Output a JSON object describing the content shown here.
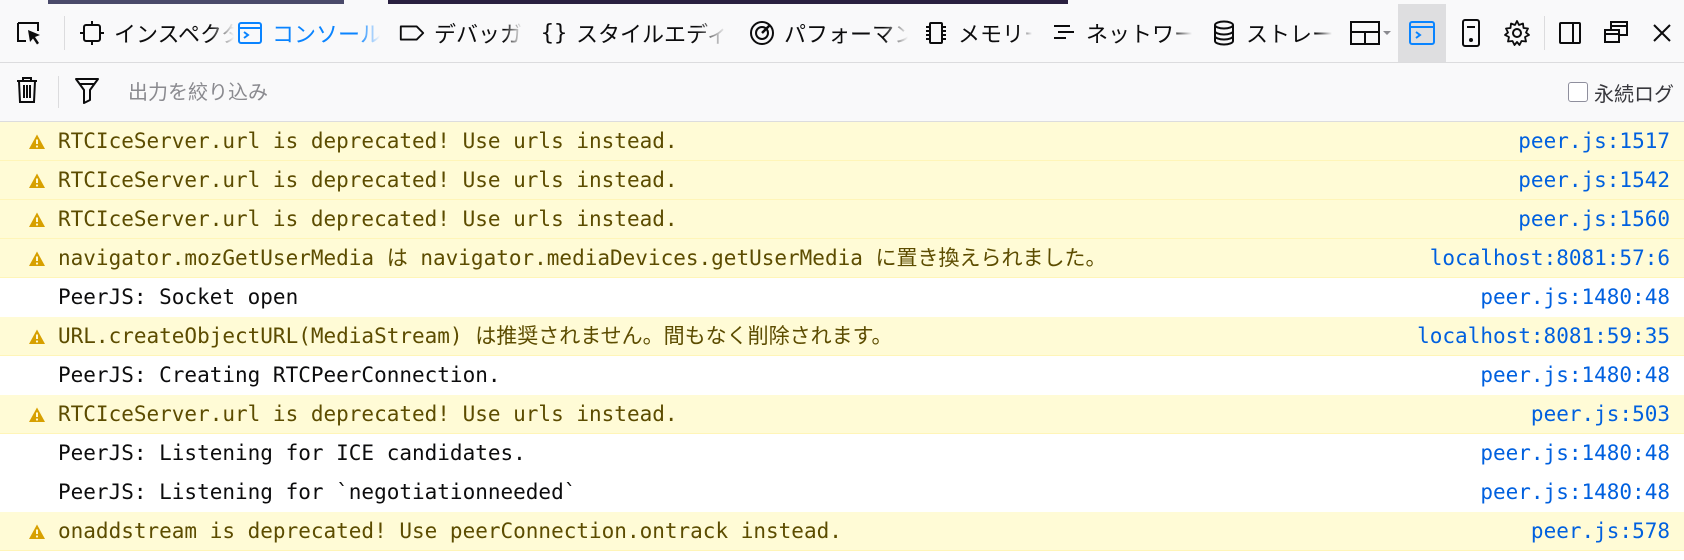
{
  "toolbar": {
    "pick_element_icon": "cursor-pick-icon",
    "tabs": [
      {
        "label": "インスペクター",
        "icon": "inspector-icon"
      },
      {
        "label": "コンソール",
        "icon": "console-icon",
        "selected": true
      },
      {
        "label": "デバッガー",
        "icon": "debugger-icon"
      },
      {
        "label": "スタイルエディター",
        "icon": "style-editor-icon"
      },
      {
        "label": "パフォーマンス",
        "icon": "performance-icon"
      },
      {
        "label": "メモリー",
        "icon": "memory-icon"
      },
      {
        "label": "ネットワーク",
        "icon": "network-icon"
      },
      {
        "label": "ストレージ",
        "icon": "storage-icon"
      }
    ],
    "right_icons": [
      "layout-menu-icon",
      "split-console-icon",
      "responsive-design-icon",
      "settings-gear-icon",
      "dock-side-icon",
      "separate-window-icon",
      "close-icon"
    ]
  },
  "filterbar": {
    "clear_icon": "trash-icon",
    "filter_icon": "filter-icon",
    "placeholder": "出力を絞り込み",
    "persist_label": "永続ログ",
    "persist_checked": false
  },
  "console": {
    "messages": [
      {
        "level": "warn",
        "text": "RTCIceServer.url is deprecated! Use urls instead.",
        "source": "peer.js:1517"
      },
      {
        "level": "warn",
        "text": "RTCIceServer.url is deprecated! Use urls instead.",
        "source": "peer.js:1542"
      },
      {
        "level": "warn",
        "text": "RTCIceServer.url is deprecated! Use urls instead.",
        "source": "peer.js:1560"
      },
      {
        "level": "warn",
        "text": "navigator.mozGetUserMedia は navigator.mediaDevices.getUserMedia に置き換えられました。",
        "source": "localhost:8081:57:6"
      },
      {
        "level": "log",
        "text": "PeerJS:  Socket open",
        "source": "peer.js:1480:48"
      },
      {
        "level": "warn",
        "text": "URL.createObjectURL(MediaStream) は推奨されません。間もなく削除されます。",
        "source": "localhost:8081:59:35"
      },
      {
        "level": "log",
        "text": "PeerJS:  Creating RTCPeerConnection.",
        "source": "peer.js:1480:48"
      },
      {
        "level": "warn",
        "text": "RTCIceServer.url is deprecated! Use urls instead.",
        "source": "peer.js:503"
      },
      {
        "level": "log",
        "text": "PeerJS:  Listening for ICE candidates.",
        "source": "peer.js:1480:48"
      },
      {
        "level": "log",
        "text": "PeerJS:  Listening for `negotiationneeded`",
        "source": "peer.js:1480:48"
      },
      {
        "level": "warn",
        "text": "onaddstream is deprecated! Use peerConnection.ontrack instead.",
        "source": "peer.js:578"
      }
    ]
  },
  "colors": {
    "accent": "#0a84ff",
    "warning_bg": "#fffbd6",
    "warning_text": "#5c4c00",
    "warning_icon": "#d7a000",
    "link": "#0060df"
  }
}
